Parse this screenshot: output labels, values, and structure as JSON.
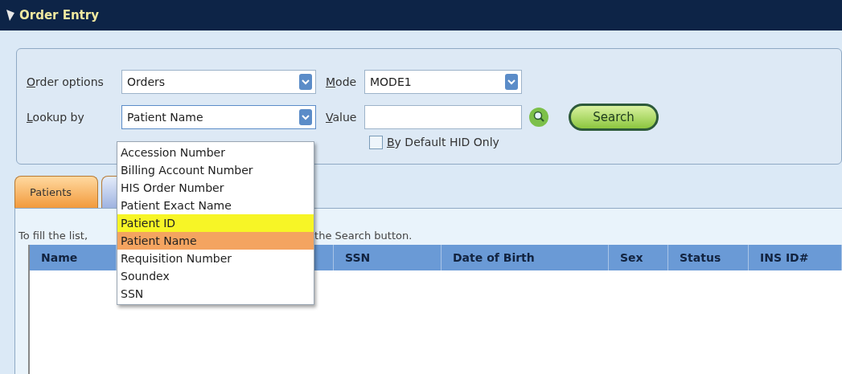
{
  "window": {
    "title": "Order Entry"
  },
  "form": {
    "order_options": {
      "label": "Order options",
      "value": "Orders"
    },
    "mode": {
      "label": "Mode",
      "value": "MODE1"
    },
    "lookup_by": {
      "label": "Lookup by",
      "value": "Patient Name",
      "expanded": true,
      "options": [
        {
          "label": "Accession Number",
          "selected": false,
          "hovered": false
        },
        {
          "label": "Billing Account Number",
          "selected": false,
          "hovered": false
        },
        {
          "label": "HIS Order Number",
          "selected": false,
          "hovered": false
        },
        {
          "label": "Patient Exact Name",
          "selected": false,
          "hovered": false
        },
        {
          "label": "Patient ID",
          "selected": false,
          "hovered": true
        },
        {
          "label": "Patient Name",
          "selected": true,
          "hovered": false
        },
        {
          "label": "Requisition Number",
          "selected": false,
          "hovered": false
        },
        {
          "label": "Soundex",
          "selected": false,
          "hovered": false
        },
        {
          "label": "SSN",
          "selected": false,
          "hovered": false
        }
      ]
    },
    "value": {
      "label": "Value"
    },
    "search_button": "Search",
    "by_default_hid_only": {
      "label": "By Default HID Only",
      "checked": false
    }
  },
  "tabs": [
    {
      "label": "Patients",
      "selected": true
    },
    {
      "selected": false
    }
  ],
  "hint": [
    "To fill the list,",
    "the Search button."
  ],
  "table": {
    "columns": [
      "Name",
      "SSN",
      "Date of Birth",
      "Sex",
      "Status",
      "INS ID#"
    ]
  }
}
